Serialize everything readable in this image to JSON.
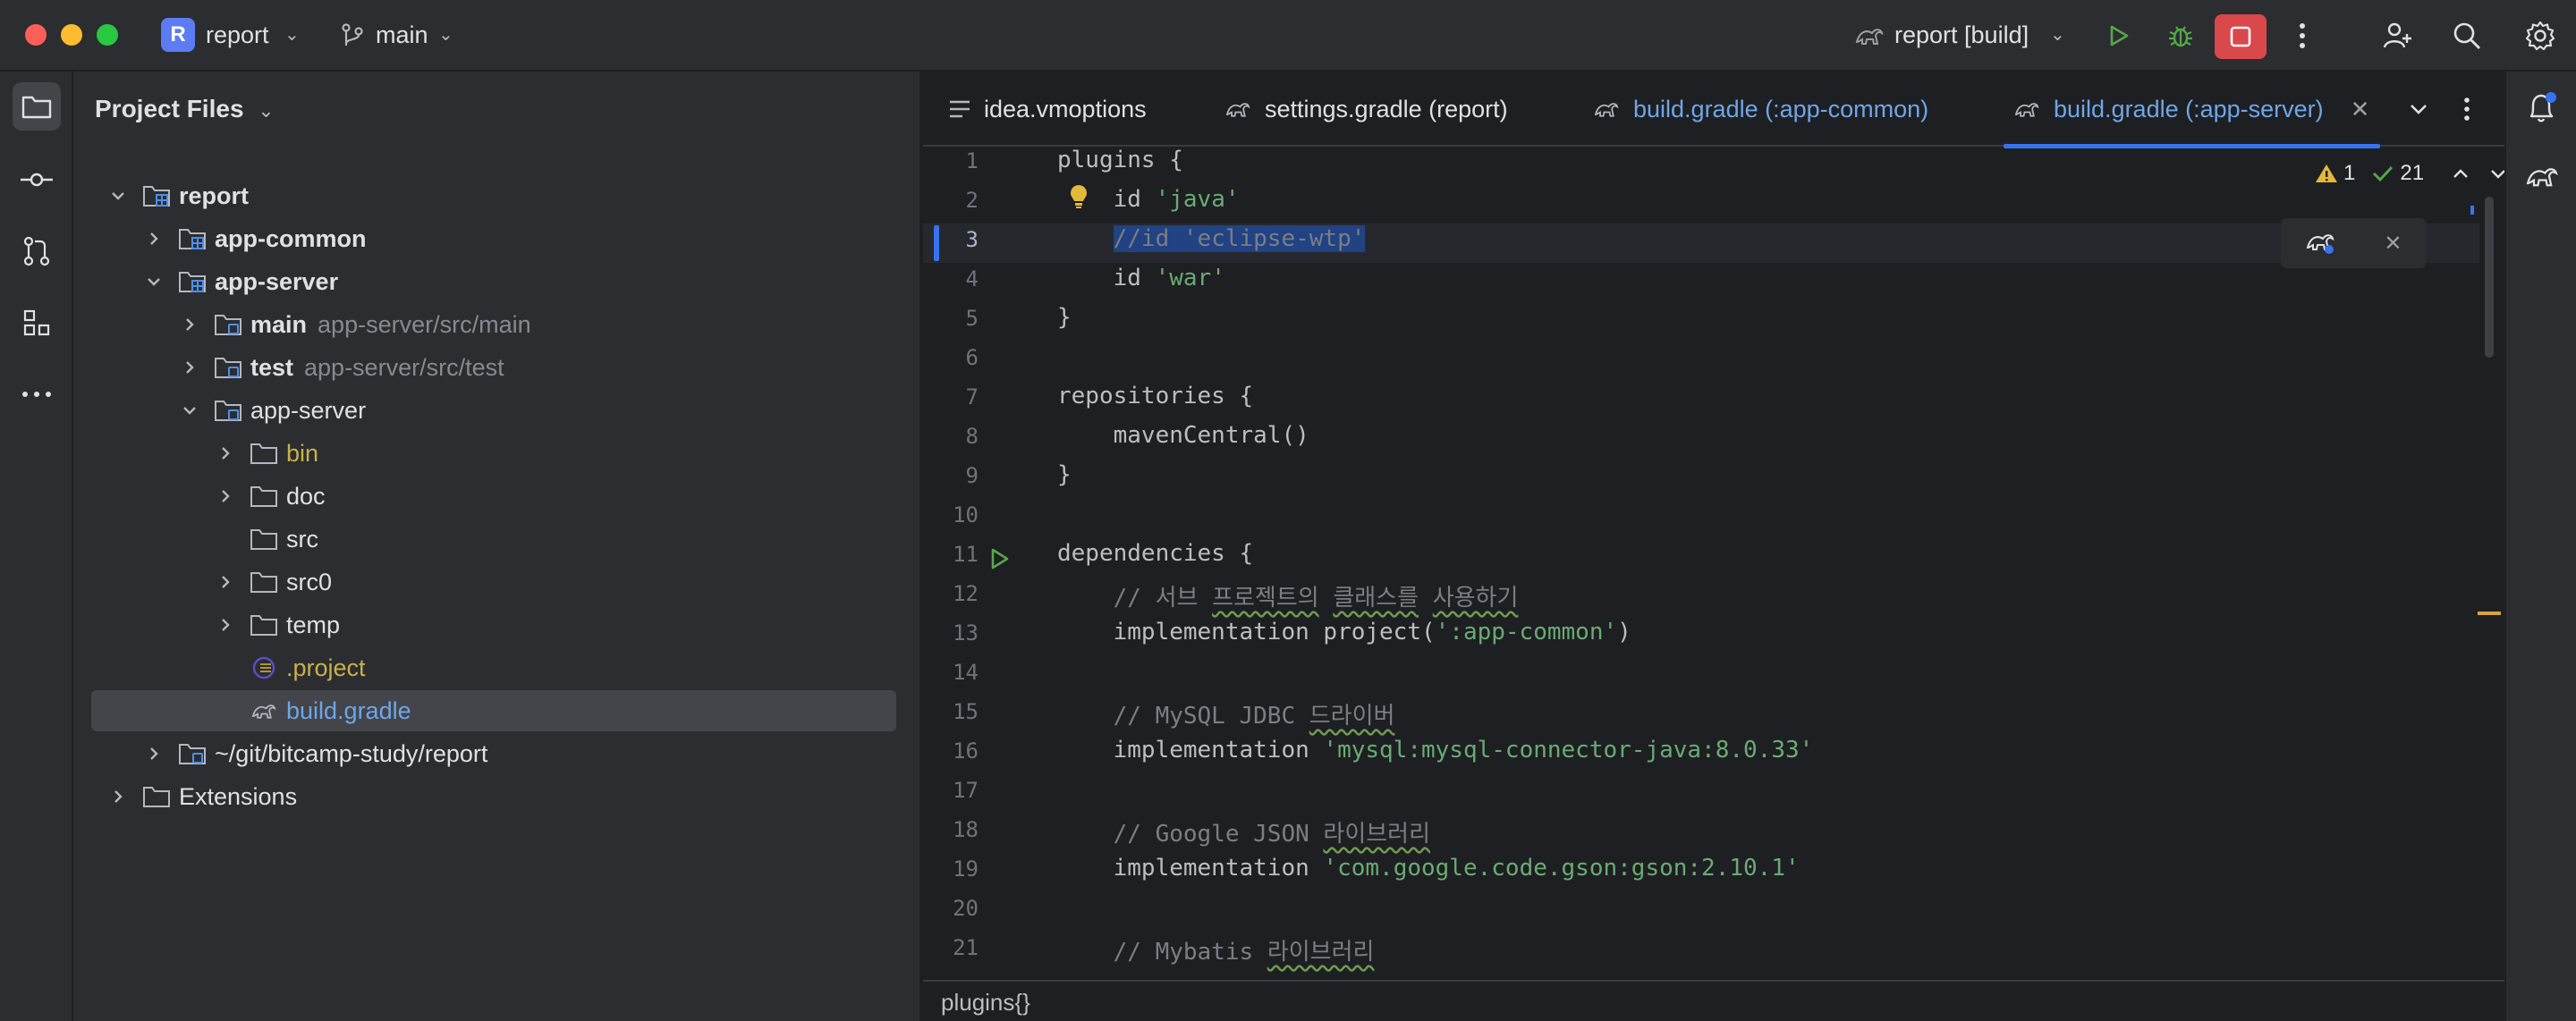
{
  "titlebar": {
    "project_badge": "R",
    "project_name": "report",
    "branch": "main",
    "run_config": "report [build]",
    "icons": [
      "branch-icon",
      "gradle-icon",
      "run-icon",
      "debug-icon",
      "stop-icon",
      "more-icon",
      "add-user-icon",
      "search-icon",
      "settings-icon"
    ]
  },
  "toolstrip": {
    "items": [
      "folder-icon",
      "commit-icon",
      "pull-request-icon",
      "structure-icon",
      "more-icon"
    ]
  },
  "project_panel": {
    "title": "Project Files",
    "tree": [
      {
        "label": "report",
        "bold": true,
        "hint": ""
      },
      {
        "label": "app-common",
        "bold": true,
        "hint": ""
      },
      {
        "label": "app-server",
        "bold": true,
        "hint": ""
      },
      {
        "label": "main",
        "bold": true,
        "hint": "app-server/src/main"
      },
      {
        "label": "test",
        "bold": true,
        "hint": "app-server/src/test"
      },
      {
        "label": "app-server",
        "bold": false,
        "hint": ""
      },
      {
        "label": "bin",
        "bold": false,
        "hint": ""
      },
      {
        "label": "doc",
        "bold": false,
        "hint": ""
      },
      {
        "label": "src",
        "bold": false,
        "hint": ""
      },
      {
        "label": "src0",
        "bold": false,
        "hint": ""
      },
      {
        "label": "temp",
        "bold": false,
        "hint": ""
      },
      {
        "label": ".project",
        "bold": false,
        "hint": ""
      },
      {
        "label": "build.gradle",
        "bold": false,
        "hint": ""
      },
      {
        "label": "~/git/bitcamp-study/report",
        "bold": false,
        "hint": ""
      },
      {
        "label": "Extensions",
        "bold": false,
        "hint": ""
      }
    ]
  },
  "editor": {
    "tabs": [
      {
        "label": "idea.vmoptions"
      },
      {
        "label": "settings.gradle (report)"
      },
      {
        "label": "build.gradle (:app-common)"
      },
      {
        "label": "build.gradle (:app-server)"
      }
    ],
    "inspections": {
      "warnings": "1",
      "ok": "21"
    },
    "line_numbers": [
      "1",
      "2",
      "3",
      "4",
      "5",
      "6",
      "7",
      "8",
      "9",
      "10",
      "11",
      "12",
      "13",
      "14",
      "15",
      "16",
      "17",
      "18",
      "19",
      "20",
      "21"
    ],
    "lines": {
      "l1": "plugins {",
      "l2_kw": "    id ",
      "l2_str": "'java'",
      "l3_sel": "//id 'eclipse-wtp'",
      "l4_kw": "    id ",
      "l4_str": "'war'",
      "l5": "}",
      "l7": "repositories {",
      "l8": "    mavenCentral()",
      "l9": "}",
      "l11": "dependencies {",
      "l12_a": "    // 서브 ",
      "l12_b": "프로젝트의",
      "l12_c": " ",
      "l12_d": "클래스를",
      "l12_e": " ",
      "l12_f": "사용하기",
      "l13_a": "    implementation project(",
      "l13_str": "':app-common'",
      "l13_b": ")",
      "l15_a": "    // MySQL JDBC ",
      "l15_b": "드라이버",
      "l16_a": "    implementation ",
      "l16_str": "'mysql:mysql-connector-java:8.0.33'",
      "l18_a": "    // Google JSON ",
      "l18_b": "라이브러리",
      "l19_a": "    implementation ",
      "l19_str": "'com.google.code.gson:gson:2.10.1'",
      "l21_a": "    // Mybatis ",
      "l21_b": "라이브러리"
    },
    "breadcrumb": "plugins{}"
  },
  "rightstrip": {
    "items": [
      "notifications-icon",
      "gradle-icon"
    ]
  }
}
